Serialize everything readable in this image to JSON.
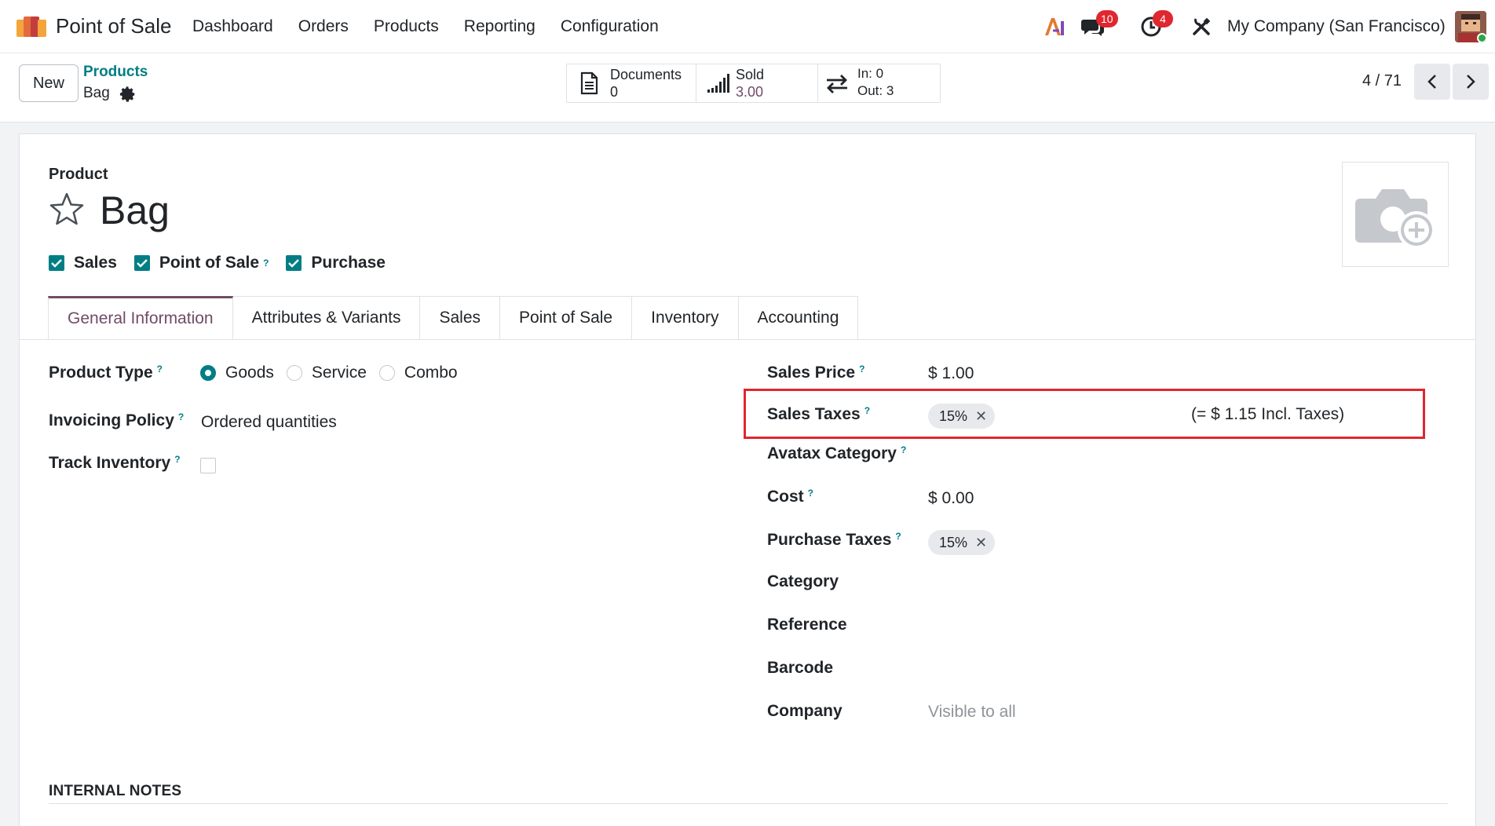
{
  "navbar": {
    "app_name": "Point of Sale",
    "menu": [
      "Dashboard",
      "Orders",
      "Products",
      "Reporting",
      "Configuration"
    ],
    "messages_badge": "10",
    "activity_badge": "4",
    "company": "My Company (San Francisco)"
  },
  "control": {
    "new_label": "New",
    "breadcrumb_parent": "Products",
    "breadcrumb_current": "Bag",
    "smart_buttons": {
      "documents_label": "Documents",
      "documents_value": "0",
      "sold_label": "Sold",
      "sold_value": "3.00",
      "in_label": "In: 0",
      "out_label": "Out: 3"
    },
    "pager": "4 / 71"
  },
  "form": {
    "product_label": "Product",
    "title": "Bag",
    "checkboxes": [
      {
        "label": "Sales",
        "checked": true
      },
      {
        "label": "Point of Sale",
        "checked": true,
        "help": "?"
      },
      {
        "label": "Purchase",
        "checked": true
      }
    ],
    "tabs": [
      "General Information",
      "Attributes & Variants",
      "Sales",
      "Point of Sale",
      "Inventory",
      "Accounting"
    ],
    "active_tab": "General Information",
    "left": {
      "product_type_label": "Product Type",
      "product_type_options": [
        "Goods",
        "Service",
        "Combo"
      ],
      "product_type_selected": "Goods",
      "invoicing_policy_label": "Invoicing Policy",
      "invoicing_policy_value": "Ordered quantities",
      "track_inventory_label": "Track Inventory"
    },
    "right": {
      "sales_price_label": "Sales Price",
      "sales_price_value": "$ 1.00",
      "sales_taxes_label": "Sales Taxes",
      "sales_taxes_tag": "15%",
      "sales_taxes_incl": "(= $ 1.15 Incl. Taxes)",
      "avatax_label": "Avatax Category",
      "cost_label": "Cost",
      "cost_value": "$ 0.00",
      "purchase_taxes_label": "Purchase Taxes",
      "purchase_taxes_tag": "15%",
      "category_label": "Category",
      "reference_label": "Reference",
      "barcode_label": "Barcode",
      "company_label": "Company",
      "company_placeholder": "Visible to all"
    },
    "help_mark": "?",
    "remove_mark": "✕",
    "internal_notes_label": "INTERNAL NOTES"
  },
  "colors": {
    "accent_teal": "#017e84",
    "brand_purple": "#714b67",
    "highlight_red": "#e0262f"
  }
}
